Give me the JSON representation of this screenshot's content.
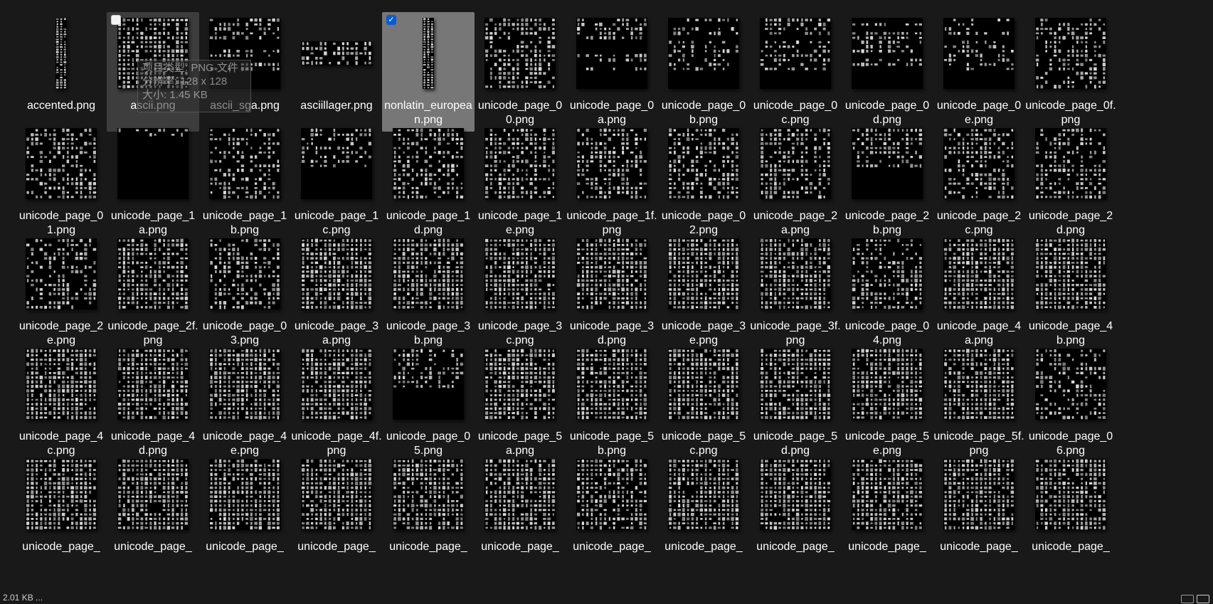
{
  "files": [
    {
      "name": "accented.png",
      "thumb": "strip",
      "density": 0.9
    },
    {
      "name": "ascii.png",
      "thumb": "ascii",
      "density": 0.8,
      "state": "hovered"
    },
    {
      "name": "ascii_sga.png",
      "thumb": "sparse",
      "density": 0.6
    },
    {
      "name": "asciillager.png",
      "thumb": "lager",
      "density": 0.7
    },
    {
      "name": "nonlatin_european.png",
      "thumb": "strip",
      "density": 0.95,
      "state": "selected"
    },
    {
      "name": "unicode_page_00.png",
      "thumb": "full",
      "density": 0.6
    },
    {
      "name": "unicode_page_0a.png",
      "thumb": "sparse",
      "density": 0.45
    },
    {
      "name": "unicode_page_0b.png",
      "thumb": "sparse",
      "density": 0.5
    },
    {
      "name": "unicode_page_0c.png",
      "thumb": "sparse",
      "density": 0.5
    },
    {
      "name": "unicode_page_0d.png",
      "thumb": "sparse",
      "density": 0.55
    },
    {
      "name": "unicode_page_0e.png",
      "thumb": "sparse",
      "density": 0.35
    },
    {
      "name": "unicode_page_0f.png",
      "thumb": "full",
      "density": 0.55
    },
    {
      "name": "unicode_page_01.png",
      "thumb": "full",
      "density": 0.55
    },
    {
      "name": "unicode_page_1a.png",
      "thumb": "topline",
      "density": 0.4
    },
    {
      "name": "unicode_page_1b.png",
      "thumb": "full",
      "density": 0.45
    },
    {
      "name": "unicode_page_1c.png",
      "thumb": "top",
      "density": 0.45
    },
    {
      "name": "unicode_page_1d.png",
      "thumb": "full",
      "density": 0.6
    },
    {
      "name": "unicode_page_1e.png",
      "thumb": "full",
      "density": 0.6
    },
    {
      "name": "unicode_page_1f.png",
      "thumb": "full",
      "density": 0.6
    },
    {
      "name": "unicode_page_02.png",
      "thumb": "full",
      "density": 0.6
    },
    {
      "name": "unicode_page_2a.png",
      "thumb": "full",
      "density": 0.6
    },
    {
      "name": "unicode_page_2b.png",
      "thumb": "top",
      "density": 0.5
    },
    {
      "name": "unicode_page_2c.png",
      "thumb": "full",
      "density": 0.55
    },
    {
      "name": "unicode_page_2d.png",
      "thumb": "full",
      "density": 0.55
    },
    {
      "name": "unicode_page_2e.png",
      "thumb": "full",
      "density": 0.45
    },
    {
      "name": "unicode_page_2f.png",
      "thumb": "full",
      "density": 0.8
    },
    {
      "name": "unicode_page_03.png",
      "thumb": "full",
      "density": 0.6
    },
    {
      "name": "unicode_page_3a.png",
      "thumb": "full",
      "density": 0.85
    },
    {
      "name": "unicode_page_3b.png",
      "thumb": "full",
      "density": 0.85
    },
    {
      "name": "unicode_page_3c.png",
      "thumb": "full",
      "density": 0.85
    },
    {
      "name": "unicode_page_3d.png",
      "thumb": "full",
      "density": 0.85
    },
    {
      "name": "unicode_page_3e.png",
      "thumb": "full",
      "density": 0.85
    },
    {
      "name": "unicode_page_3f.png",
      "thumb": "full",
      "density": 0.85
    },
    {
      "name": "unicode_page_04.png",
      "thumb": "full",
      "density": 0.6
    },
    {
      "name": "unicode_page_4a.png",
      "thumb": "full",
      "density": 0.85
    },
    {
      "name": "unicode_page_4b.png",
      "thumb": "full",
      "density": 0.85
    },
    {
      "name": "unicode_page_4c.png",
      "thumb": "full",
      "density": 0.85
    },
    {
      "name": "unicode_page_4d.png",
      "thumb": "full",
      "density": 0.85
    },
    {
      "name": "unicode_page_4e.png",
      "thumb": "full",
      "density": 0.85
    },
    {
      "name": "unicode_page_4f.png",
      "thumb": "full",
      "density": 0.85
    },
    {
      "name": "unicode_page_05.png",
      "thumb": "top",
      "density": 0.5
    },
    {
      "name": "unicode_page_5a.png",
      "thumb": "full",
      "density": 0.85
    },
    {
      "name": "unicode_page_5b.png",
      "thumb": "full",
      "density": 0.85
    },
    {
      "name": "unicode_page_5c.png",
      "thumb": "full",
      "density": 0.85
    },
    {
      "name": "unicode_page_5d.png",
      "thumb": "full",
      "density": 0.85
    },
    {
      "name": "unicode_page_5e.png",
      "thumb": "full",
      "density": 0.85
    },
    {
      "name": "unicode_page_5f.png",
      "thumb": "full",
      "density": 0.85
    },
    {
      "name": "unicode_page_06.png",
      "thumb": "full",
      "density": 0.55
    },
    {
      "name": "unicode_page_",
      "thumb": "full",
      "density": 0.85
    },
    {
      "name": "unicode_page_",
      "thumb": "full",
      "density": 0.85
    },
    {
      "name": "unicode_page_",
      "thumb": "full",
      "density": 0.85
    },
    {
      "name": "unicode_page_",
      "thumb": "full",
      "density": 0.85
    },
    {
      "name": "unicode_page_",
      "thumb": "full",
      "density": 0.85
    },
    {
      "name": "unicode_page_",
      "thumb": "full",
      "density": 0.85
    },
    {
      "name": "unicode_page_",
      "thumb": "full",
      "density": 0.75
    },
    {
      "name": "unicode_page_",
      "thumb": "full",
      "density": 0.85
    },
    {
      "name": "unicode_page_",
      "thumb": "full",
      "density": 0.85
    },
    {
      "name": "unicode_page_",
      "thumb": "full",
      "density": 0.85
    },
    {
      "name": "unicode_page_",
      "thumb": "full",
      "density": 0.85
    },
    {
      "name": "unicode_page_",
      "thumb": "full",
      "density": 0.85
    }
  ],
  "tooltip": {
    "line1": "项目类型: PNG 文件",
    "line2": "分辨率: 128 x 128",
    "line3": "大小: 1.45 KB"
  },
  "status": {
    "text": "2.01 KB ..."
  },
  "colors": {
    "background": "#191919",
    "selected_tile": "#777777",
    "checkbox_checked": "#0a5bd3",
    "thumb_glyph": "#dcdcdc"
  },
  "icons": {
    "checkbox": "checkbox-icon",
    "checked": "check-icon",
    "details_view": "details-view-icon",
    "thumbnail_view": "thumbnail-view-icon"
  }
}
